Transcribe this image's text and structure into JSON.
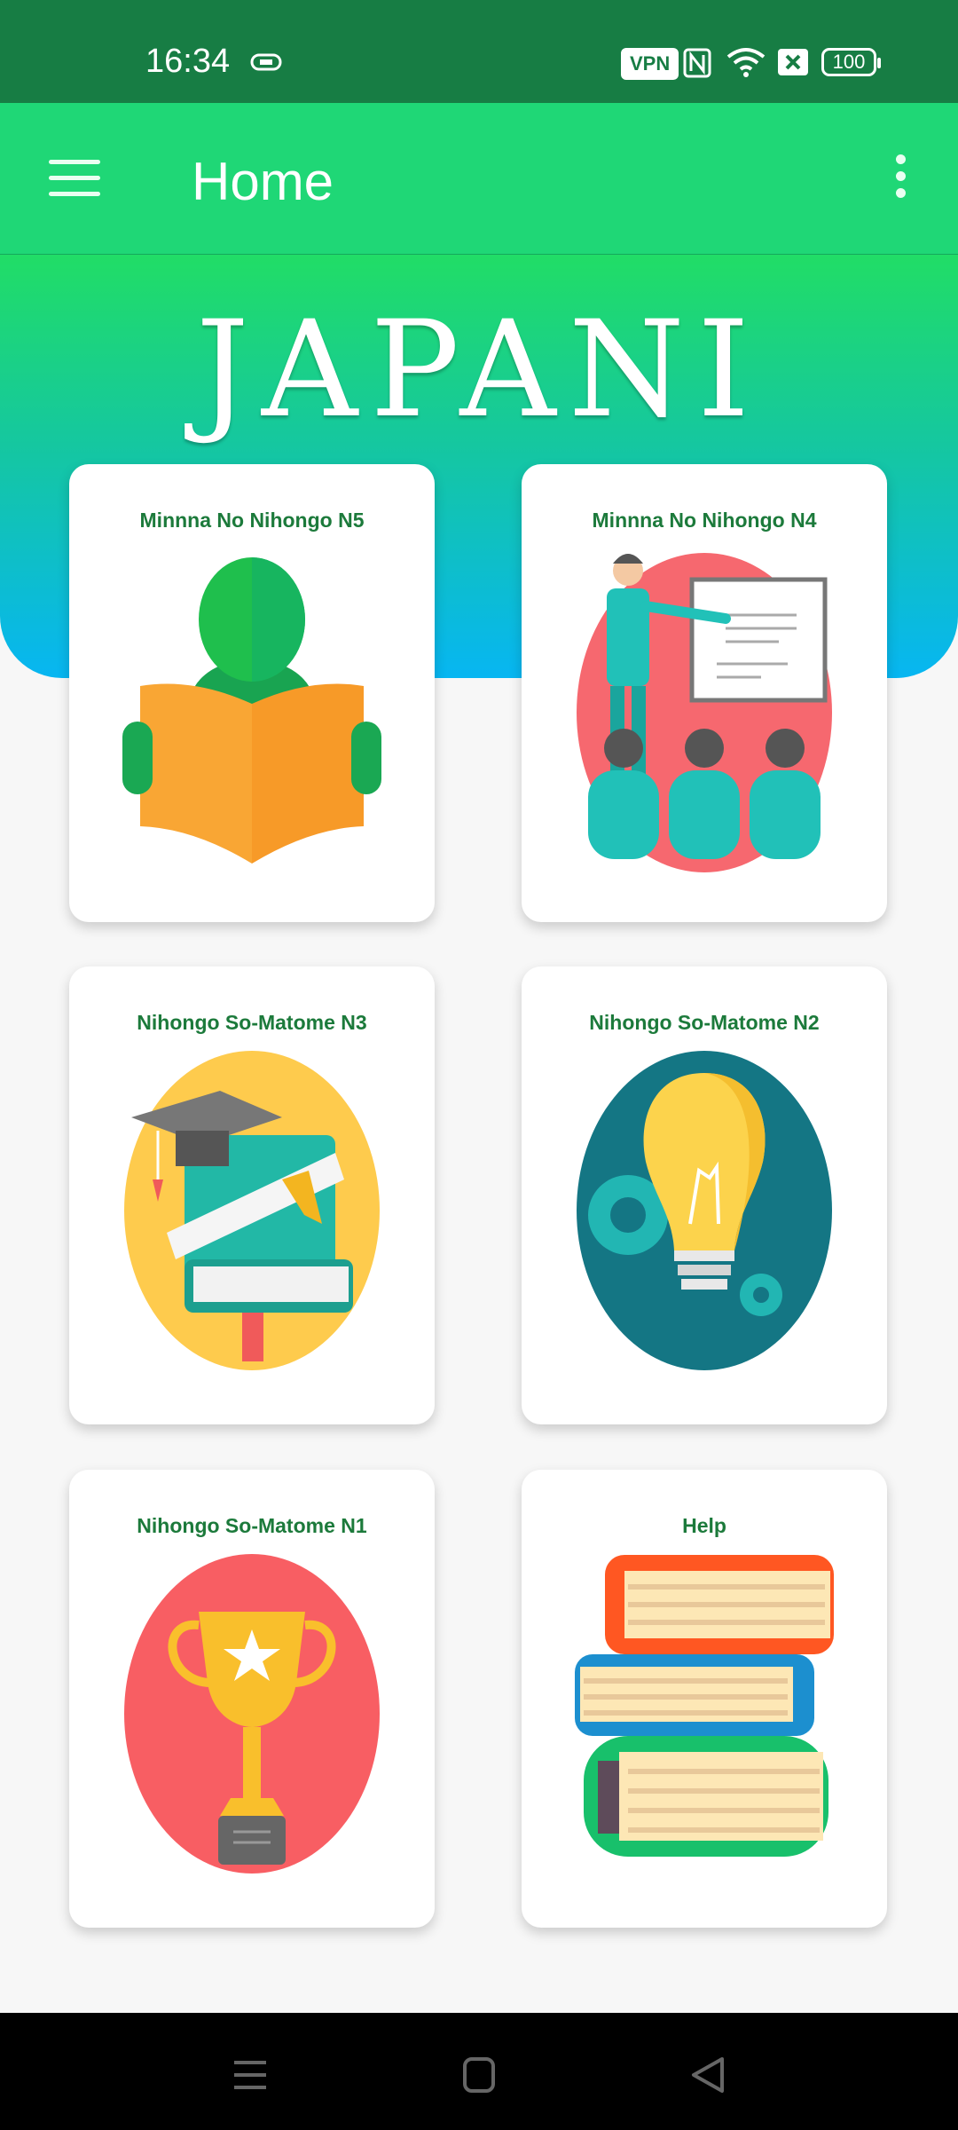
{
  "status_bar": {
    "time": "16:34",
    "vpn": "VPN",
    "battery": "100"
  },
  "app_bar": {
    "title": "Home"
  },
  "hero": {
    "title": "JAPANI"
  },
  "cards": [
    {
      "title": "Minnna No Nihongo N5",
      "icon": "reading-person-icon"
    },
    {
      "title": "Minnna No Nihongo N4",
      "icon": "teacher-presentation-icon"
    },
    {
      "title": "Nihongo So-Matome N3",
      "icon": "graduation-books-icon"
    },
    {
      "title": "Nihongo So-Matome N2",
      "icon": "lightbulb-gear-icon"
    },
    {
      "title": "Nihongo So-Matome N1",
      "icon": "trophy-icon"
    },
    {
      "title": "Help",
      "icon": "book-stack-icon"
    }
  ],
  "colors": {
    "status_bar": "#177d44",
    "app_bar": "#1fd776",
    "card_title": "#1c7a3b"
  }
}
